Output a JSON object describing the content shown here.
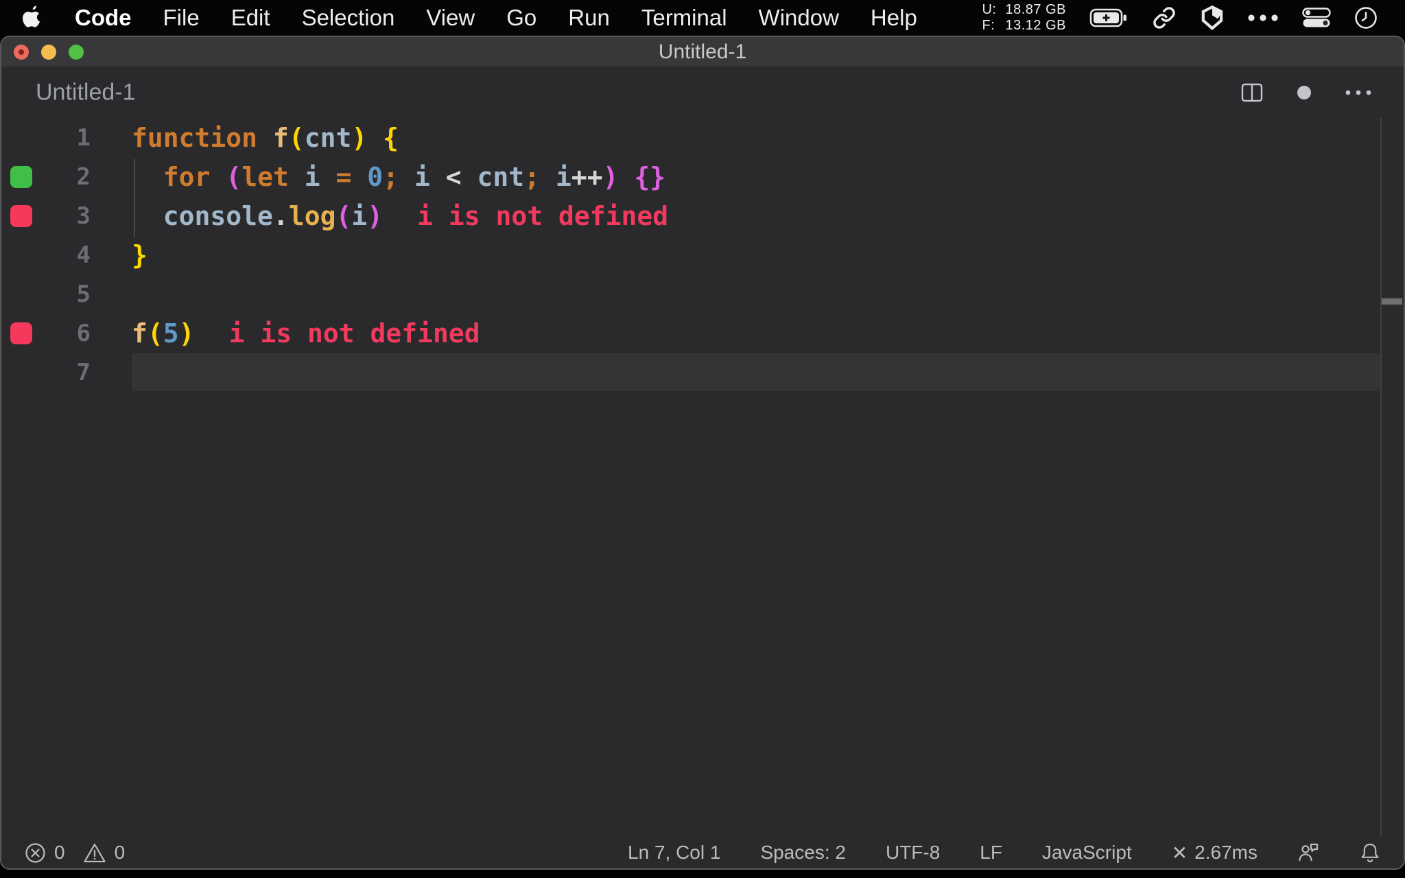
{
  "menubar": {
    "items": [
      "Code",
      "File",
      "Edit",
      "Selection",
      "View",
      "Go",
      "Run",
      "Terminal",
      "Window",
      "Help"
    ],
    "memory": {
      "used_label": "U:",
      "used_value": "18.87 GB",
      "free_label": "F:",
      "free_value": "13.12 GB"
    },
    "tray_icons": [
      "battery-charging-icon",
      "link-icon",
      "cube-icon",
      "ellipsis-icon",
      "control-center-icon",
      "clock-icon"
    ]
  },
  "window": {
    "title": "Untitled-1",
    "tab_label": "Untitled-1",
    "header_icons": [
      "split-editor-icon",
      "unsaved-dot-icon",
      "more-actions-icon"
    ]
  },
  "editor": {
    "language_mode": "JavaScript",
    "lines": [
      {
        "num": "1",
        "tokens": [
          {
            "t": "function",
            "c": "kw"
          },
          {
            "t": " ",
            "c": "pl"
          },
          {
            "t": "f",
            "c": "fn"
          },
          {
            "t": "(",
            "c": "b1"
          },
          {
            "t": "cnt",
            "c": "var"
          },
          {
            "t": ")",
            "c": "b1"
          },
          {
            "t": " ",
            "c": "pl"
          },
          {
            "t": "{",
            "c": "b1"
          }
        ]
      },
      {
        "num": "2",
        "gutter": "green",
        "tokens": [
          {
            "t": "  ",
            "c": "pl"
          },
          {
            "t": "for",
            "c": "kw"
          },
          {
            "t": " ",
            "c": "pl"
          },
          {
            "t": "(",
            "c": "b2"
          },
          {
            "t": "let",
            "c": "kw"
          },
          {
            "t": " ",
            "c": "pl"
          },
          {
            "t": "i",
            "c": "var"
          },
          {
            "t": " ",
            "c": "pl"
          },
          {
            "t": "=",
            "c": "opo"
          },
          {
            "t": " ",
            "c": "pl"
          },
          {
            "t": "0",
            "c": "num"
          },
          {
            "t": ";",
            "c": "opo"
          },
          {
            "t": " ",
            "c": "pl"
          },
          {
            "t": "i",
            "c": "var"
          },
          {
            "t": " ",
            "c": "pl"
          },
          {
            "t": "<",
            "c": "op"
          },
          {
            "t": " ",
            "c": "pl"
          },
          {
            "t": "cnt",
            "c": "var"
          },
          {
            "t": ";",
            "c": "opo"
          },
          {
            "t": " ",
            "c": "pl"
          },
          {
            "t": "i",
            "c": "var"
          },
          {
            "t": "++",
            "c": "op"
          },
          {
            "t": ")",
            "c": "b2"
          },
          {
            "t": " ",
            "c": "pl"
          },
          {
            "t": "{}",
            "c": "b2"
          }
        ]
      },
      {
        "num": "3",
        "gutter": "red",
        "annotation": "i is not defined",
        "tokens": [
          {
            "t": "  ",
            "c": "pl"
          },
          {
            "t": "console",
            "c": "var"
          },
          {
            "t": ".",
            "c": "op"
          },
          {
            "t": "log",
            "c": "mth"
          },
          {
            "t": "(",
            "c": "b2"
          },
          {
            "t": "i",
            "c": "var"
          },
          {
            "t": ")",
            "c": "b2"
          }
        ]
      },
      {
        "num": "4",
        "tokens": [
          {
            "t": "}",
            "c": "b1"
          }
        ]
      },
      {
        "num": "5",
        "tokens": []
      },
      {
        "num": "6",
        "gutter": "red",
        "annotation": "i is not defined",
        "tokens": [
          {
            "t": "f",
            "c": "fn"
          },
          {
            "t": "(",
            "c": "b1"
          },
          {
            "t": "5",
            "c": "num"
          },
          {
            "t": ")",
            "c": "b1"
          }
        ]
      },
      {
        "num": "7",
        "current": true,
        "tokens": []
      }
    ]
  },
  "statusbar": {
    "errors": "0",
    "warnings": "0",
    "cursor": "Ln 7, Col 1",
    "indentation": "Spaces: 2",
    "encoding": "UTF-8",
    "eol": "LF",
    "language": "JavaScript",
    "perf_icon": "✕",
    "perf_value": "2.67ms"
  },
  "colors": {
    "keyword": "#d07c2e",
    "function_name": "#e9bd78",
    "method": "#e7b14f",
    "bracket_level1": "#fdd405",
    "bracket_level2": "#e060df",
    "variable": "#a2b8ca",
    "number": "#609ac9",
    "inline_error": "#f13a5e",
    "gutter_pass": "#3fbe48",
    "gutter_error": "#f5395d",
    "editor_bg": "#2a2a2c",
    "titlebar_bg": "#38383a"
  }
}
